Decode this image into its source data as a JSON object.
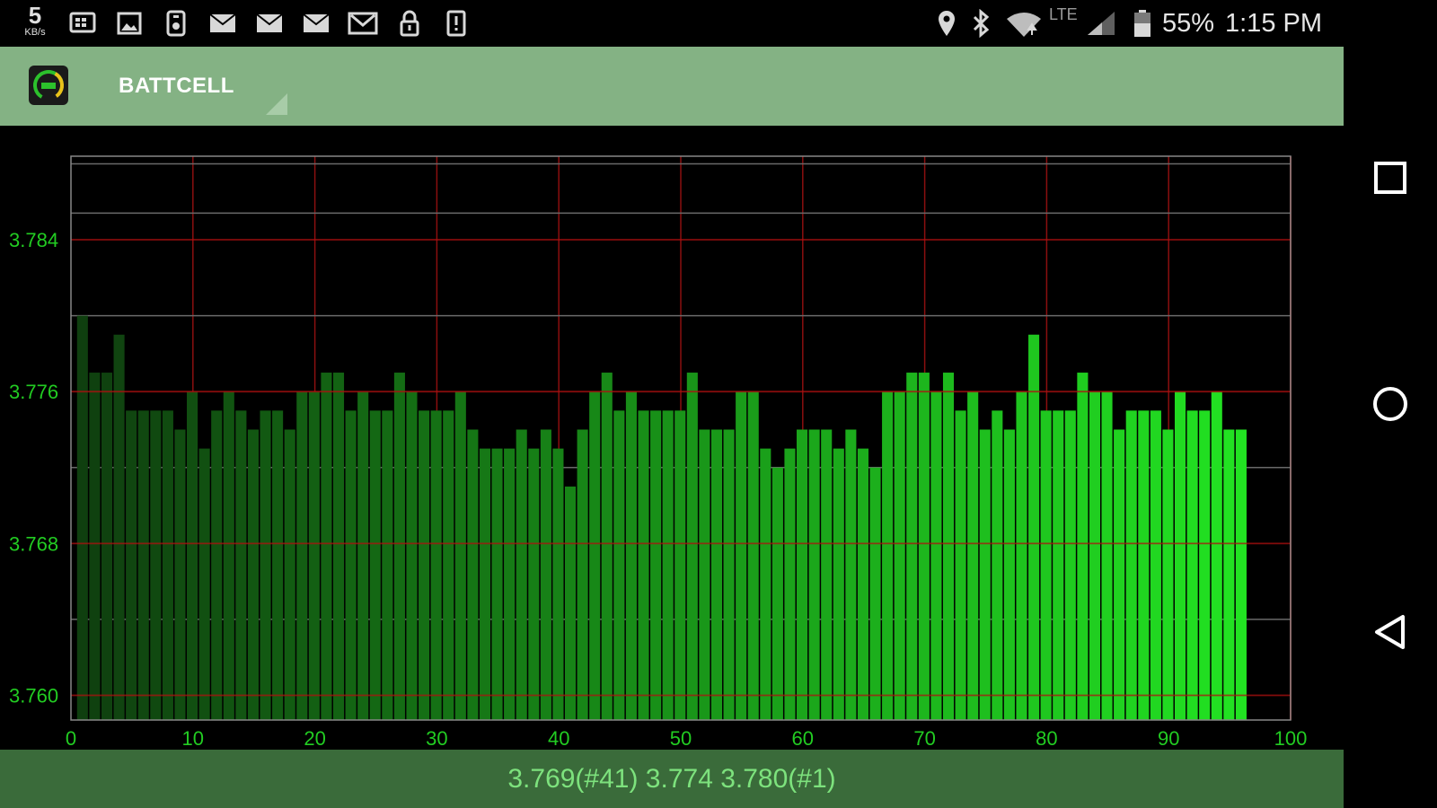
{
  "status_bar": {
    "net_speed_value": "5",
    "net_speed_unit": "KB/s",
    "battery_percent": "55%",
    "time": "1:15 PM",
    "network_type": "LTE",
    "left_icons": [
      "grid-icon",
      "image-icon",
      "device-icon",
      "mail-icon",
      "mail-icon",
      "mail-icon",
      "gmail-icon",
      "lock-icon",
      "alert-icon"
    ],
    "right_icons": [
      "location-icon",
      "bluetooth-icon",
      "wifi-icon",
      "signal-icon",
      "battery-icon"
    ]
  },
  "action_bar": {
    "title": "BATTCELL",
    "background": "#84b284"
  },
  "footer": {
    "summary": "3.769(#41) 3.774 3.780(#1)",
    "background": "#3a6b3a",
    "text_color": "#7de27d"
  },
  "nav_bar": {
    "buttons": [
      "recent-apps-icon",
      "home-icon",
      "back-icon"
    ]
  },
  "chart_data": {
    "type": "bar",
    "title": "",
    "xlabel": "",
    "ylabel": "",
    "xlim": [
      0,
      100
    ],
    "ylim": [
      3.7587,
      3.7884
    ],
    "x_ticks": [
      0,
      10,
      20,
      30,
      40,
      50,
      60,
      70,
      80,
      90,
      100
    ],
    "x_tick_labels": [
      "0",
      "10",
      "20",
      "30",
      "40",
      "50",
      "60",
      "70",
      "80",
      "90",
      "100"
    ],
    "y_ticks": [
      3.76,
      3.768,
      3.776,
      3.784
    ],
    "y_tick_labels": [
      "3.760",
      "3.768",
      "3.776",
      "3.784"
    ],
    "grid": true,
    "bar_color_start": "#0f3f0f",
    "bar_color_end": "#22e322",
    "x": [
      1,
      2,
      3,
      4,
      5,
      6,
      7,
      8,
      9,
      10,
      11,
      12,
      13,
      14,
      15,
      16,
      17,
      18,
      19,
      20,
      21,
      22,
      23,
      24,
      25,
      26,
      27,
      28,
      29,
      30,
      31,
      32,
      33,
      34,
      35,
      36,
      37,
      38,
      39,
      40,
      41,
      42,
      43,
      44,
      45,
      46,
      47,
      48,
      49,
      50,
      51,
      52,
      53,
      54,
      55,
      56,
      57,
      58,
      59,
      60,
      61,
      62,
      63,
      64,
      65,
      66,
      67,
      68,
      69,
      70,
      71,
      72,
      73,
      74,
      75,
      76,
      77,
      78,
      79,
      80,
      81,
      82,
      83,
      84,
      85,
      86,
      87,
      88,
      89,
      90,
      91,
      92,
      93,
      94,
      95,
      96
    ],
    "values": [
      3.78,
      3.777,
      3.777,
      3.779,
      3.775,
      3.775,
      3.775,
      3.775,
      3.774,
      3.776,
      3.773,
      3.775,
      3.776,
      3.775,
      3.774,
      3.775,
      3.775,
      3.774,
      3.776,
      3.776,
      3.777,
      3.777,
      3.775,
      3.776,
      3.775,
      3.775,
      3.777,
      3.776,
      3.775,
      3.775,
      3.775,
      3.776,
      3.774,
      3.773,
      3.773,
      3.773,
      3.774,
      3.773,
      3.774,
      3.773,
      3.771,
      3.774,
      3.776,
      3.777,
      3.775,
      3.776,
      3.775,
      3.775,
      3.775,
      3.775,
      3.777,
      3.774,
      3.774,
      3.774,
      3.776,
      3.776,
      3.773,
      3.772,
      3.773,
      3.774,
      3.774,
      3.774,
      3.773,
      3.774,
      3.773,
      3.772,
      3.776,
      3.776,
      3.777,
      3.777,
      3.776,
      3.777,
      3.775,
      3.776,
      3.774,
      3.775,
      3.774,
      3.776,
      3.779,
      3.775,
      3.775,
      3.775,
      3.777,
      3.776,
      3.776,
      3.774,
      3.775,
      3.775,
      3.775,
      3.774,
      3.776,
      3.775,
      3.775,
      3.776,
      3.774,
      3.774
    ]
  }
}
